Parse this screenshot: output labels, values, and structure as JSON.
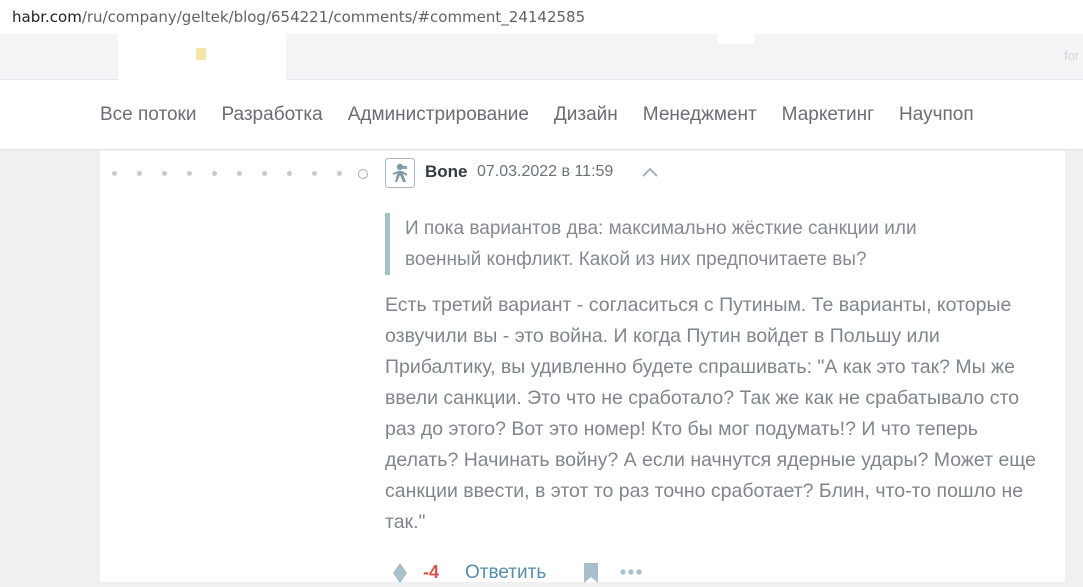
{
  "browser": {
    "url_host": "habr.com",
    "url_path": "/ru/company/geltek/blog/654221/comments/#comment_24142585"
  },
  "top_strip": {
    "ghost_right": "for"
  },
  "nav": {
    "items": [
      {
        "label": "Все потоки"
      },
      {
        "label": "Разработка"
      },
      {
        "label": "Администрирование"
      },
      {
        "label": "Дизайн"
      },
      {
        "label": "Менеджмент"
      },
      {
        "label": "Маркетинг"
      },
      {
        "label": "Научпоп"
      }
    ]
  },
  "comment": {
    "username": "Bone",
    "datetime": "07.03.2022 в 11:59",
    "quote": "И пока вариантов два: максимально жёсткие санкции или военный конфликт. Какой из них предпочитаете вы?",
    "body": "Есть третий вариант - согласиться с Путиным. Те варианты, которые озвучили вы - это война. И когда Путин войдет в Польшу или Прибалтику, вы удивленно будете спрашивать: \"А как это так? Мы же ввели санкции. Это что не сработало? Так же как не срабатывало сто раз до этого? Вот это номер! Кто бы мог подумать!? И что теперь делать? Начинать войну? А если начнутся ядерные удары? Может еще санкции ввести, в этот то раз точно сработает? Блин, что-то пошло не так.\"",
    "score": "-4",
    "reply_label": "Ответить",
    "icons": {
      "parent": "chevron-up-icon",
      "vote": "vote-diamond-icon",
      "bookmark": "bookmark-icon",
      "more": "more-dots-icon"
    }
  },
  "colors": {
    "score_negative": "#d9534f",
    "reply_link": "#548eaa",
    "quote_border": "#a6bfca"
  }
}
